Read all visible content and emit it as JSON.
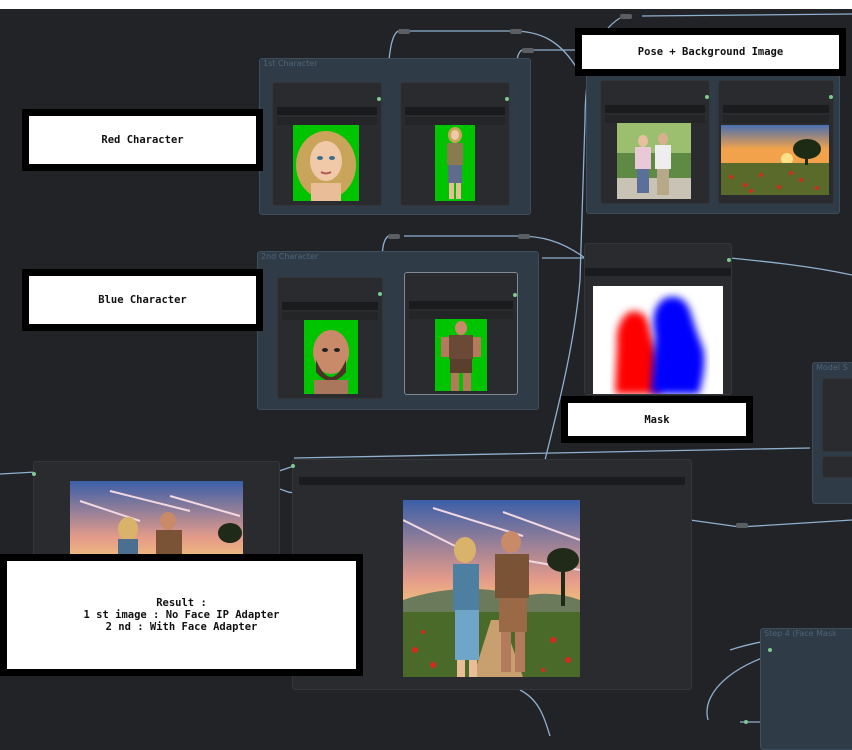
{
  "groups": {
    "first_character": "1st Character",
    "second_character": "2nd Character",
    "model_settings": "Model S",
    "step4": "Step 4 (Face Mask"
  },
  "labels": {
    "red_character": "Red Character",
    "blue_character": "Blue Character",
    "pose_background": "Pose + Background Image",
    "mask": "Mask",
    "result": "Result :\n1 st image : No Face IP Adapter\n2 nd : With Face Adapter"
  },
  "colors": {
    "canvas": "#222326",
    "group_fill": "#2f3b47",
    "wire": "#8fb0d0",
    "link_dot": "#7ec98f",
    "mask_red": "#ff0000",
    "mask_blue": "#0000ff",
    "green_screen": "#00c400"
  }
}
